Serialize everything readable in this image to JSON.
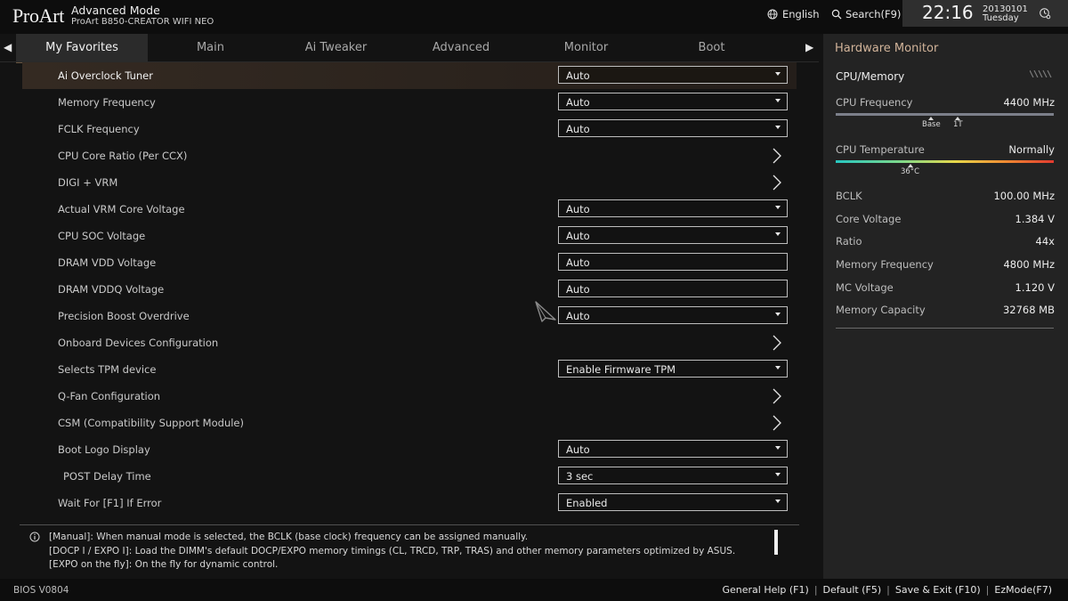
{
  "header": {
    "brand": "ProArt",
    "mode": "Advanced Mode",
    "model": "ProArt B850-CREATOR WIFI NEO",
    "language": "English",
    "search": "Search(F9)",
    "time": "22:16",
    "date": "20130101",
    "weekday": "Tuesday"
  },
  "tabs": [
    "My Favorites",
    "Main",
    "Ai Tweaker",
    "Advanced",
    "Monitor",
    "Boot"
  ],
  "settings": [
    {
      "label": "Ai Overclock Tuner",
      "type": "dropdown",
      "value": "Auto"
    },
    {
      "label": "Memory Frequency",
      "type": "dropdown",
      "value": "Auto"
    },
    {
      "label": "FCLK Frequency",
      "type": "dropdown",
      "value": "Auto"
    },
    {
      "label": "CPU Core Ratio (Per CCX)",
      "type": "submenu"
    },
    {
      "label": "DIGI + VRM",
      "type": "submenu"
    },
    {
      "label": "Actual VRM Core Voltage",
      "type": "dropdown",
      "value": "Auto"
    },
    {
      "label": "CPU SOC Voltage",
      "type": "dropdown",
      "value": "Auto"
    },
    {
      "label": "DRAM VDD Voltage",
      "type": "text",
      "value": "Auto"
    },
    {
      "label": "DRAM VDDQ Voltage",
      "type": "text",
      "value": "Auto"
    },
    {
      "label": "Precision Boost Overdrive",
      "type": "dropdown",
      "value": "Auto"
    },
    {
      "label": "Onboard Devices Configuration",
      "type": "submenu"
    },
    {
      "label": "Selects TPM device",
      "type": "dropdown",
      "value": "Enable Firmware TPM"
    },
    {
      "label": "Q-Fan Configuration",
      "type": "submenu"
    },
    {
      "label": "CSM (Compatibility Support Module)",
      "type": "submenu"
    },
    {
      "label": "Boot Logo Display",
      "type": "dropdown",
      "value": "Auto"
    },
    {
      "label": "POST Delay Time",
      "type": "dropdown",
      "value": "3 sec"
    },
    {
      "label": "Wait For [F1] If Error",
      "type": "dropdown",
      "value": "Enabled"
    }
  ],
  "help": {
    "lines": [
      "[Manual]: When manual mode is selected, the BCLK (base clock) frequency can be assigned manually.",
      "[DOCP I / EXPO I]:  Load the DIMM's default DOCP/EXPO memory timings (CL, TRCD, TRP, TRAS) and other memory parameters optimized by ASUS.",
      "[EXPO on the fly]: On the fly for dynamic control."
    ]
  },
  "monitor": {
    "title": "Hardware Monitor",
    "section": "CPU/Memory",
    "cpu_freq_label": "CPU Frequency",
    "cpu_freq_value": "4400 MHz",
    "marker_base": "Base",
    "marker_1t": "1T",
    "cpu_temp_label": "CPU Temperature",
    "cpu_temp_value": "Normally",
    "temp_marker": "36°C",
    "rows": [
      {
        "label": "BCLK",
        "value": "100.00 MHz"
      },
      {
        "label": "Core Voltage",
        "value": "1.384 V"
      },
      {
        "label": "Ratio",
        "value": "44x"
      },
      {
        "label": "Memory Frequency",
        "value": "4800 MHz"
      },
      {
        "label": "MC Voltage",
        "value": "1.120 V"
      },
      {
        "label": "Memory Capacity",
        "value": "32768 MB"
      }
    ]
  },
  "footer": {
    "version": "BIOS V0804",
    "keys": [
      "General Help (F1)",
      "Default (F5)",
      "Save & Exit (F10)",
      "EzMode(F7)"
    ]
  }
}
